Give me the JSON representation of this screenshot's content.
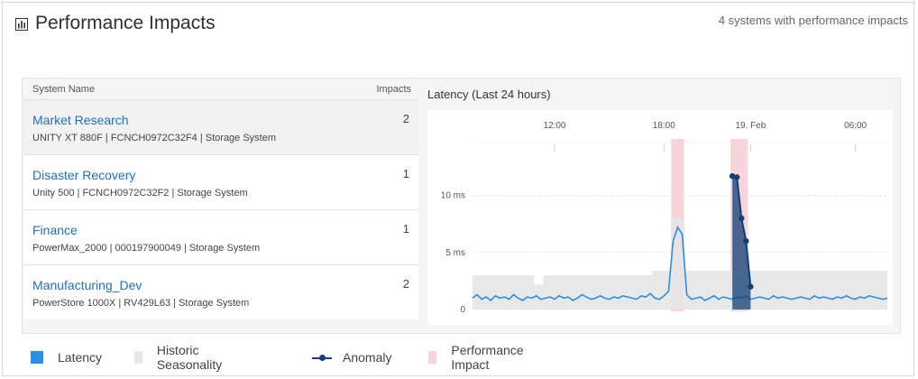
{
  "header": {
    "title": "Performance Impacts",
    "summary": "4 systems with performance impacts",
    "icon": "bar-chart-icon"
  },
  "table": {
    "col_system": "System Name",
    "col_impacts": "Impacts",
    "rows": [
      {
        "name": "Market Research",
        "detail": "UNITY XT 880F | FCNCH0972C32F4 | Storage System",
        "impacts": "2",
        "selected": true
      },
      {
        "name": "Disaster Recovery",
        "detail": "Unity 500 | FCNCH0972C32F2 | Storage System",
        "impacts": "1",
        "selected": false
      },
      {
        "name": "Finance",
        "detail": "PowerMax_2000 | 000197900049 | Storage System",
        "impacts": "1",
        "selected": false
      },
      {
        "name": "Manufacturing_Dev",
        "detail": "PowerStore 1000X | RV429L63 | Storage System",
        "impacts": "2",
        "selected": false
      }
    ]
  },
  "chart_data": {
    "type": "line",
    "title": "Latency (Last 24 hours)",
    "x_ticks": [
      "12:00",
      "18:00",
      "19. Feb",
      "06:00"
    ],
    "y_ticks": [
      "0",
      "5 ms",
      "10 ms"
    ],
    "ylim": [
      0,
      14
    ],
    "series": [
      {
        "name": "Latency",
        "color": "#2b8fe3",
        "values": [
          1.0,
          1.3,
          0.9,
          1.1,
          0.8,
          1.2,
          1.0,
          1.1,
          0.9,
          1.3,
          1.0,
          0.8,
          1.1,
          1.0,
          1.2,
          0.9,
          1.0,
          1.1,
          0.9,
          1.2,
          1.0,
          1.1,
          0.8,
          1.0,
          1.3,
          1.1,
          0.9,
          1.0,
          1.2,
          1.0,
          0.9,
          1.1,
          1.0,
          1.2,
          1.1,
          1.0,
          0.9,
          1.2,
          1.1,
          1.4,
          1.0,
          0.9,
          1.2,
          1.6,
          6.0,
          7.2,
          6.6,
          1.3,
          0.9,
          1.0,
          1.1,
          0.8,
          1.0,
          1.2,
          0.9,
          1.1,
          1.0,
          0.9,
          1.1,
          1.0,
          1.2,
          0.9,
          1.0,
          1.1,
          1.0,
          0.9,
          1.2,
          1.0,
          1.1,
          1.0,
          0.9,
          1.0,
          1.1,
          1.0,
          0.9,
          1.2,
          1.0,
          1.1,
          1.0,
          0.9,
          1.1,
          1.0,
          1.2,
          1.0,
          0.9,
          1.1,
          1.0,
          1.2,
          1.1,
          1.0,
          0.9,
          1.0
        ]
      },
      {
        "name": "Historic Seasonality",
        "color": "#e6e6e6",
        "values": [
          3.0,
          3.0,
          3.0,
          3.0,
          3.0,
          3.0,
          3.0,
          3.0,
          3.0,
          3.0,
          3.0,
          3.0,
          3.0,
          3.0,
          2.2,
          2.2,
          3.0,
          3.0,
          3.0,
          3.0,
          3.0,
          3.0,
          3.0,
          3.0,
          3.0,
          3.0,
          3.0,
          3.0,
          3.0,
          3.0,
          3.0,
          3.0,
          3.0,
          3.0,
          3.0,
          3.0,
          3.0,
          3.0,
          3.0,
          3.0,
          3.4,
          3.4,
          3.4,
          3.4,
          8.0,
          8.0,
          8.0,
          3.4,
          3.4,
          3.4,
          3.4,
          3.4,
          3.4,
          3.4,
          3.4,
          3.4,
          3.4,
          3.4,
          3.4,
          3.4,
          3.4,
          3.4,
          3.4,
          3.4,
          3.4,
          3.4,
          3.4,
          3.4,
          3.4,
          3.4,
          3.4,
          3.4,
          3.4,
          3.4,
          3.4,
          3.4,
          3.4,
          3.4,
          3.4,
          3.4,
          3.4,
          3.4,
          3.4,
          3.4,
          3.4,
          3.4,
          3.4,
          3.4,
          3.4,
          3.4,
          3.4,
          3.4
        ]
      },
      {
        "name": "Anomaly",
        "color": "#123f74",
        "points": [
          [
            57,
            11.7
          ],
          [
            58,
            11.6
          ],
          [
            59,
            8.0
          ],
          [
            60,
            6.0
          ],
          [
            61,
            2.0
          ]
        ]
      }
    ],
    "impact_windows": [
      [
        44,
        46
      ],
      [
        57,
        60
      ]
    ],
    "legend": [
      {
        "label": "Latency",
        "color": "#2b8fe3",
        "kind": "square"
      },
      {
        "label": "Historic Seasonality",
        "color": "#e6e6e6",
        "kind": "square"
      },
      {
        "label": "Anomaly",
        "color": "#123f74",
        "kind": "line-dot"
      },
      {
        "label": "Performance Impact",
        "color": "#f7d4d9",
        "kind": "square"
      }
    ],
    "impact_color": "#f7d4d9"
  }
}
